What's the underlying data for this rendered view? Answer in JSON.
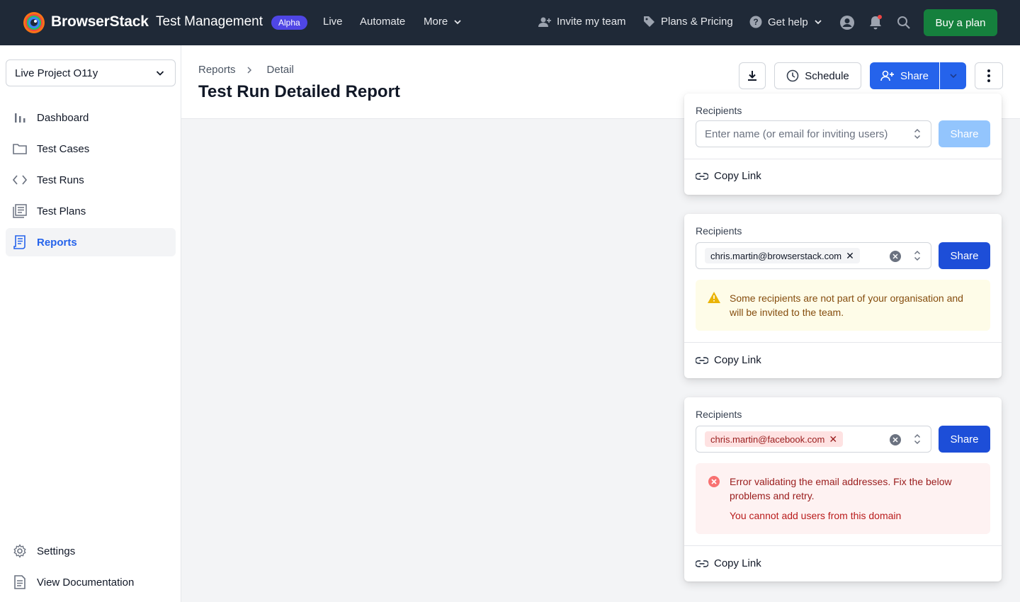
{
  "brand": {
    "name": "BrowserStack",
    "product": "Test Management",
    "badge": "Alpha"
  },
  "topnav": {
    "live": "Live",
    "automate": "Automate",
    "more": "More",
    "invite": "Invite my team",
    "plans": "Plans & Pricing",
    "help": "Get help",
    "buy": "Buy a plan"
  },
  "sidebar": {
    "project": "Live Project O11y",
    "items": [
      {
        "label": "Dashboard"
      },
      {
        "label": "Test Cases"
      },
      {
        "label": "Test Runs"
      },
      {
        "label": "Test Plans"
      },
      {
        "label": "Reports"
      }
    ],
    "bottom": [
      {
        "label": "Settings"
      },
      {
        "label": "View Documentation"
      }
    ]
  },
  "header": {
    "breadcrumb": [
      "Reports",
      "Detail"
    ],
    "title": "Test Run Detailed Report",
    "schedule": "Schedule",
    "share": "Share"
  },
  "panels": {
    "recipients_label": "Recipients",
    "placeholder": "Enter name (or email for inviting users)",
    "share": "Share",
    "copy_link": "Copy Link",
    "chip_valid": "chris.martin@browserstack.com",
    "chip_invalid": "chris.martin@facebook.com",
    "warning_text": "Some recipients are not part of your organisation and will be invited to the team.",
    "error_text": "Error validating the email addresses. Fix the below problems and retry.",
    "error_sub": "You cannot add users from this domain"
  },
  "colors": {
    "topnav_bg": "#1f2937",
    "primary": "#2563eb",
    "buy_green": "#15803d",
    "alpha_badge": "#4f46e5",
    "warning_bg": "#fefce8",
    "error_bg": "#fef2f2"
  }
}
